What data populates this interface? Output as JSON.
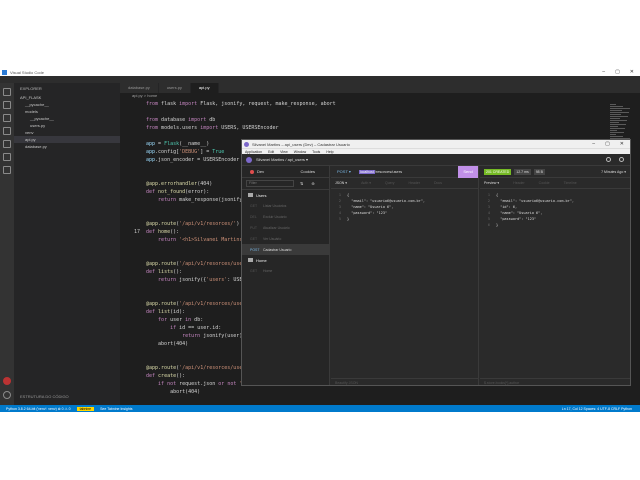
{
  "vscode": {
    "title": "Visual Studio Code",
    "explorer_header": "EXPLORER",
    "tree": [
      {
        "label": "API_FLASK",
        "indent": 0
      },
      {
        "label": "__pycache__",
        "indent": 1
      },
      {
        "label": "models",
        "indent": 1
      },
      {
        "label": "__pycache__",
        "indent": 2
      },
      {
        "label": "users.py",
        "indent": 2
      },
      {
        "label": "venv",
        "indent": 1
      },
      {
        "label": "api.py",
        "indent": 1
      },
      {
        "label": "database.py",
        "indent": 1
      }
    ],
    "selected_index": 6,
    "outline_label": "ESTRUTURA DO CÓDIGO",
    "tabs": [
      {
        "label": "database.py",
        "active": false
      },
      {
        "label": "users.py",
        "active": false
      },
      {
        "label": "api.py",
        "active": true
      }
    ],
    "breadcrumb": "api.py > home",
    "current_line": "17",
    "lines": [
      {
        "n": "",
        "html": "<span class='kw'>from</span> flask <span class='kw'>import</span> Flask, jsonify, request, make_response, abort"
      },
      {
        "n": "",
        "html": ""
      },
      {
        "n": "",
        "html": "<span class='kw'>from</span> database <span class='kw'>import</span> db"
      },
      {
        "n": "",
        "html": "<span class='kw'>from</span> models.users <span class='kw'>import</span> USERS, USERSEncoder"
      },
      {
        "n": "",
        "html": ""
      },
      {
        "n": "",
        "html": "<span class='vr'>app</span> = <span class='cl'>Flask</span>(__name__)"
      },
      {
        "n": "",
        "html": "<span class='vr'>app</span>.config[<span class='st'>'DEBUG'</span>] = <span class='cl'>True</span>"
      },
      {
        "n": "",
        "html": "<span class='vr'>app</span>.json_encoder = USERSEncoder"
      },
      {
        "n": "",
        "html": ""
      },
      {
        "n": "",
        "html": ""
      },
      {
        "n": "",
        "html": "<span class='dc'>@app.errorhandler</span>(404)"
      },
      {
        "n": "",
        "html": "<span class='kw'>def</span> <span class='fn'>not_found</span>(error):"
      },
      {
        "n": "",
        "html": "    <span class='kw'>return</span> make_response(jsonify({<span class='st'>'error'</span>: <span class='st'>'Not found'</span>}), 404)"
      },
      {
        "n": "",
        "html": ""
      },
      {
        "n": "",
        "html": ""
      },
      {
        "n": "",
        "html": "<span class='dc'>@app.route</span>(<span class='st'>'/api/v1/resorces/'</span>)"
      },
      {
        "n": "17",
        "html": "<span class='kw'>def</span> <span class='fn'>home</span>():"
      },
      {
        "n": "",
        "html": "    <span class='kw'>return</span> <span class='st'>'&lt;h1&gt;Silvanei Martins&lt;/h1&gt;'</span>"
      },
      {
        "n": "",
        "html": ""
      },
      {
        "n": "",
        "html": ""
      },
      {
        "n": "",
        "html": "<span class='dc'>@app.route</span>(<span class='st'>'/api/v1/resorces/users'</span>)"
      },
      {
        "n": "",
        "html": "<span class='kw'>def</span> <span class='fn'>lists</span>():"
      },
      {
        "n": "",
        "html": "    <span class='kw'>return</span> jsonify({<span class='st'>'users'</span>: USERS})"
      },
      {
        "n": "",
        "html": ""
      },
      {
        "n": "",
        "html": ""
      },
      {
        "n": "",
        "html": "<span class='dc'>@app.route</span>(<span class='st'>'/api/v1/resorces/users/&lt;int:id&gt;'</span>)"
      },
      {
        "n": "",
        "html": "<span class='kw'>def</span> <span class='fn'>list</span>(id):"
      },
      {
        "n": "",
        "html": "    <span class='kw'>for</span> user <span class='kw'>in</span> db:"
      },
      {
        "n": "",
        "html": "        <span class='kw'>if</span> id == user.id:"
      },
      {
        "n": "",
        "html": "            <span class='kw'>return</span> jsonify(user)"
      },
      {
        "n": "",
        "html": "    abort(404)"
      },
      {
        "n": "",
        "html": ""
      },
      {
        "n": "",
        "html": ""
      },
      {
        "n": "",
        "html": "<span class='dc'>@app.route</span>(<span class='st'>'/api/v1/resorces/users'</span>, methods=[<span class='st'>'POST'</span>])"
      },
      {
        "n": "",
        "html": "<span class='kw'>def</span> <span class='fn'>create</span>():"
      },
      {
        "n": "",
        "html": "    <span class='kw'>if</span> <span class='kw'>not</span> request.json <span class='kw'>or</span> <span class='kw'>not</span> <span class='st'>'name'</span> <span class='kw'>in</span> request.json:"
      },
      {
        "n": "",
        "html": "        abort(404)"
      }
    ],
    "status_left": "Python 3.8.2 64-bit ('venv': venv)   ⊗ 0 ⚠ 0",
    "status_tabnine": "tabnine",
    "status_tabnine_hint": "See Tabnine Insights",
    "status_right": "Ln 17, Col 12   Spaces: 4   UTF-8   CRLF   Python"
  },
  "insomnia": {
    "window_title": "Silvanei Martins – api_users (Dev) – Cadastrar Usuario",
    "menu": [
      "Application",
      "Edit",
      "View",
      "Window",
      "Tools",
      "Help"
    ],
    "breadcrumb": "Silvanei Martins / api_users ▾",
    "environment": "Dev",
    "cookies": "Cookies",
    "filter_placeholder": "Filter",
    "folder": "Users",
    "requests": [
      {
        "method": "GET",
        "name": "Listar Usuários",
        "active": false
      },
      {
        "method": "DEL",
        "name": "Excluir Usuário",
        "active": false
      },
      {
        "method": "PUT",
        "name": "Atualizar Usuário",
        "active": false
      },
      {
        "method": "GET",
        "name": "Ver Usuário",
        "active": false
      },
      {
        "method": "POST",
        "name": "Cadastrar Usuario",
        "active": true
      }
    ],
    "folder2": "Home",
    "requests2": [
      {
        "method": "GET",
        "name": "Home",
        "active": false
      }
    ],
    "method": "POST ▾",
    "url_tag": "localhost",
    "url_rest": "/resorces/users",
    "send": "Send",
    "req_tabs": [
      "JSON ▾",
      "Auth ▾",
      "Query",
      "Header",
      "Docs"
    ],
    "body_lines": [
      "{",
      "  \"email\": \"usuario6@usuario.com.br\",",
      "  \"name\": \"Usuario 6\",",
      "  \"password\": \"123\"",
      "}"
    ],
    "body_footer": "Beautify JSON",
    "status_code": "201 CREATED",
    "time": "12.7 ms",
    "size": "98 B",
    "ago": "7 Minutes Ago ▾",
    "resp_tabs": [
      "Preview ▾",
      "Header",
      "Cookie",
      "Timeline"
    ],
    "resp_lines": [
      "{",
      "  \"email\": \"usuario6@usuario.com.br\",",
      "  \"id\": 6,",
      "  \"name\": \"Usuario 6\",",
      "  \"password\": \"123\"",
      "}"
    ],
    "resp_footer": "$.store.books[*].author"
  }
}
